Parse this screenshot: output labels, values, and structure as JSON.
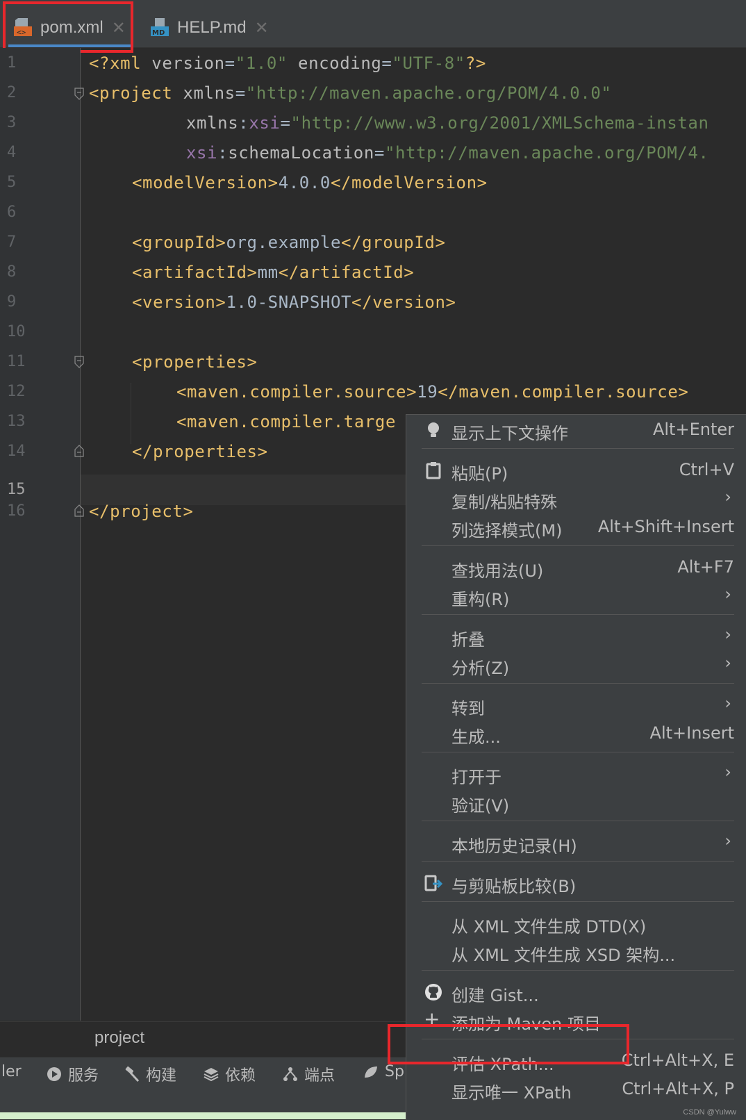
{
  "tabs": [
    {
      "label": "pom.xml",
      "active": true,
      "icon": "xml-file-icon"
    },
    {
      "label": "HELP.md",
      "active": false,
      "icon": "markdown-file-icon"
    }
  ],
  "editor": {
    "current_line": 15,
    "lines": [
      {
        "n": "1"
      },
      {
        "n": "2"
      },
      {
        "n": "3"
      },
      {
        "n": "4"
      },
      {
        "n": "5"
      },
      {
        "n": "6"
      },
      {
        "n": "7"
      },
      {
        "n": "8"
      },
      {
        "n": "9"
      },
      {
        "n": "10"
      },
      {
        "n": "11"
      },
      {
        "n": "12"
      },
      {
        "n": "13"
      },
      {
        "n": "14"
      },
      {
        "n": "15"
      },
      {
        "n": "16"
      }
    ],
    "tokens": {
      "l1": [
        "<?xml ",
        "version",
        "=",
        "\"1.0\"",
        " encoding",
        "=",
        "\"UTF-8\"",
        "?>"
      ],
      "l2": [
        "<project ",
        "xmlns",
        "=",
        "\"http://maven.apache.org/POM/4.0.0\""
      ],
      "l3": [
        "xmlns",
        ":",
        "xsi",
        "=",
        "\"http://www.w3.org/2001/XMLSchema-instan"
      ],
      "l4": [
        "xsi",
        ":",
        "schemaLocation",
        "=",
        "\"http://maven.apache.org/POM/4."
      ],
      "l5": [
        "<modelVersion>",
        "4.0.0",
        "</modelVersion>"
      ],
      "l7": [
        "<groupId>",
        "org.example",
        "</groupId>"
      ],
      "l8": [
        "<artifactId>",
        "mm",
        "</artifactId>"
      ],
      "l9": [
        "<version>",
        "1.0-SNAPSHOT",
        "</version>"
      ],
      "l11": [
        "<properties>"
      ],
      "l12": [
        "<maven.compiler.source>",
        "19",
        "</maven.compiler.source>"
      ],
      "l13": [
        "<maven.compiler.targe"
      ],
      "l14": [
        "</properties>"
      ],
      "l16": [
        "</project>"
      ]
    }
  },
  "breadcrumb": "project",
  "tool_windows": [
    {
      "label": "ler",
      "icon": ""
    },
    {
      "label": "服务",
      "icon": "services-icon"
    },
    {
      "label": "构建",
      "icon": "hammer-icon"
    },
    {
      "label": "依赖",
      "icon": "layers-icon"
    },
    {
      "label": "端点",
      "icon": "endpoints-icon"
    },
    {
      "label": "Sp",
      "icon": "spring-leaf-icon"
    }
  ],
  "context_menu": {
    "items": [
      {
        "label": "显示上下文操作",
        "shortcut": "Alt+Enter",
        "icon": "bulb-icon"
      },
      {
        "label": "粘贴(P)",
        "shortcut": "Ctrl+V",
        "icon": "clipboard-icon"
      },
      {
        "label": "复制/粘贴特殊",
        "submenu": true
      },
      {
        "label": "列选择模式(M)",
        "shortcut": "Alt+Shift+Insert"
      },
      {
        "label": "查找用法(U)",
        "shortcut": "Alt+F7"
      },
      {
        "label": "重构(R)",
        "submenu": true
      },
      {
        "label": "折叠",
        "submenu": true
      },
      {
        "label": "分析(Z)",
        "submenu": true
      },
      {
        "label": "转到",
        "submenu": true
      },
      {
        "label": "生成...",
        "shortcut": "Alt+Insert"
      },
      {
        "label": "打开于",
        "submenu": true
      },
      {
        "label": "验证(V)"
      },
      {
        "label": "本地历史记录(H)",
        "submenu": true
      },
      {
        "label": "与剪贴板比较(B)",
        "icon": "compare-clipboard-icon"
      },
      {
        "label": "从 XML 文件生成 DTD(X)"
      },
      {
        "label": "从 XML 文件生成 XSD 架构..."
      },
      {
        "label": "创建 Gist...",
        "icon": "github-icon"
      },
      {
        "label": "添加为 Maven 项目",
        "icon": "plus-icon"
      },
      {
        "label": "评估 XPath...",
        "shortcut": "Ctrl+Alt+X, E"
      },
      {
        "label": "显示唯一 XPath",
        "shortcut": "Ctrl+Alt+X, P"
      }
    ]
  },
  "watermark": "CSDN @Yulww",
  "colors": {
    "editor_bg": "#2b2b2b",
    "tag": "#e8bf6a",
    "string": "#6a8759",
    "namespace": "#9876aa",
    "highlight_border": "#e8272c",
    "active_tab_underline": "#4a88c7"
  }
}
